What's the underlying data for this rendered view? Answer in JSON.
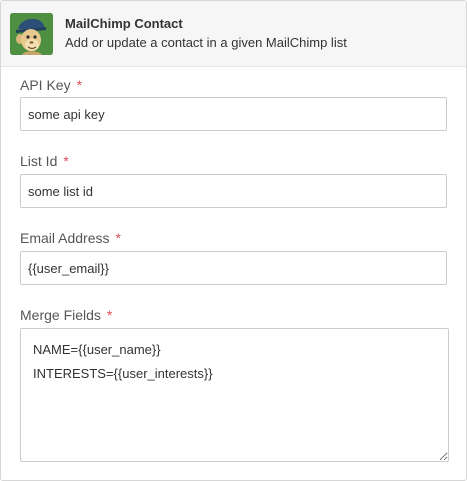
{
  "header": {
    "logo_icon": "mailchimp-logo-icon",
    "title": "MailChimp Contact",
    "subtitle": "Add or update a contact in a given MailChimp list"
  },
  "fields": {
    "api_key": {
      "label": "API Key",
      "required_mark": "*",
      "value": "some api key"
    },
    "list_id": {
      "label": "List Id",
      "required_mark": "*",
      "value": "some list id"
    },
    "email_address": {
      "label": "Email Address",
      "required_mark": "*",
      "value": "{{user_email}}"
    },
    "merge_fields": {
      "label": "Merge Fields",
      "required_mark": "*",
      "value": "NAME={{user_name}}\nINTERESTS={{user_interests}}"
    }
  },
  "colors": {
    "required": "#e0505a",
    "header_bg": "#f6f6f6",
    "border": "#cccccc"
  }
}
